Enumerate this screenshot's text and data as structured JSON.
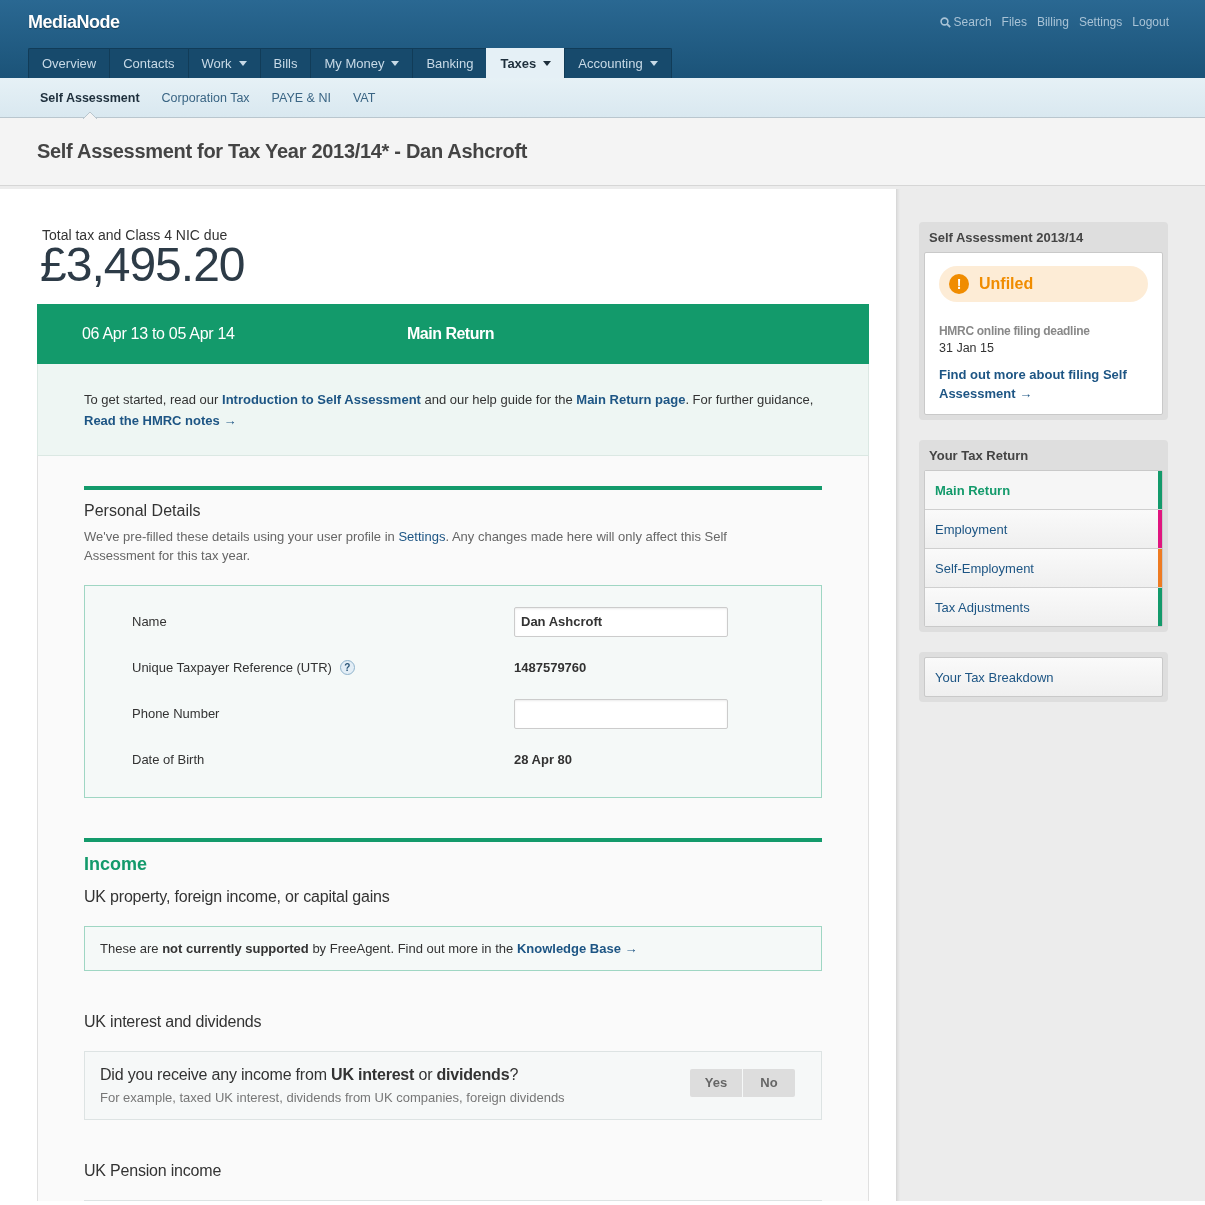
{
  "header": {
    "logo": "MediaNode",
    "links": [
      {
        "kind": "search",
        "label": "Search"
      },
      {
        "kind": "plain",
        "label": "Files"
      },
      {
        "kind": "plain",
        "label": "Billing"
      },
      {
        "kind": "plain",
        "label": "Settings"
      },
      {
        "kind": "plain",
        "label": "Logout"
      }
    ]
  },
  "nav": {
    "tabs": [
      {
        "label": "Overview",
        "dropdown": false,
        "selected": false
      },
      {
        "label": "Contacts",
        "dropdown": false,
        "selected": false
      },
      {
        "label": "Work",
        "dropdown": true,
        "selected": false
      },
      {
        "label": "Bills",
        "dropdown": false,
        "selected": false
      },
      {
        "label": "My Money",
        "dropdown": true,
        "selected": false
      },
      {
        "label": "Banking",
        "dropdown": false,
        "selected": false
      },
      {
        "label": "Taxes",
        "dropdown": true,
        "selected": true
      },
      {
        "label": "Accounting",
        "dropdown": true,
        "selected": false
      }
    ]
  },
  "subnav": {
    "items": [
      {
        "label": "Self Assessment",
        "selected": true
      },
      {
        "label": "Corporation Tax",
        "selected": false
      },
      {
        "label": "PAYE & NI",
        "selected": false
      },
      {
        "label": "VAT",
        "selected": false
      }
    ]
  },
  "page_title": "Self Assessment for Tax Year 2013/14* - Dan Ashcroft",
  "summary": {
    "label": "Total tax and Class 4 NIC due",
    "amount": "£3,495.20"
  },
  "return_bar": {
    "period": "06 Apr 13 to 05 Apr 14",
    "title": "Main Return"
  },
  "intro": {
    "parts": [
      {
        "kind": "text",
        "text": "To get started, read our "
      },
      {
        "kind": "link",
        "text": "Introduction to Self Assessment"
      },
      {
        "kind": "text",
        "text": " and our help guide for the "
      },
      {
        "kind": "link",
        "text": "Main Return page"
      },
      {
        "kind": "text",
        "text": ". For further guidance, "
      },
      {
        "kind": "link",
        "text": "Read the HMRC notes →"
      }
    ]
  },
  "personal_details": {
    "heading": "Personal Details",
    "description": [
      {
        "kind": "text",
        "text": "We've pre-filled these details using your user profile in "
      },
      {
        "kind": "link",
        "text": "Settings"
      },
      {
        "kind": "text",
        "text": ". Any changes made here will only affect this Self Assessment for this tax year."
      }
    ],
    "fields": [
      {
        "kind": "input",
        "label": "Name",
        "value": "Dan Ashcroft"
      },
      {
        "kind": "text",
        "label": "Unique Taxpayer Reference (UTR)",
        "help": "?",
        "value": "1487579760"
      },
      {
        "kind": "input",
        "label": "Phone Number"
      },
      {
        "kind": "text",
        "label": "Date of Birth",
        "value": "28 Apr 80"
      }
    ]
  },
  "income": {
    "heading": "Income",
    "sections": [
      {
        "kind": "notice",
        "title": "UK property, foreign income, or capital gains",
        "parts": [
          {
            "kind": "text",
            "text": "These are **not currently supported** by FreeAgent. Find out more in the "
          },
          {
            "kind": "link",
            "text": "Knowledge Base →"
          }
        ]
      },
      {
        "kind": "question",
        "title": "UK interest and dividends",
        "question": "Did you receive any income from **UK interest** or **dividends**?",
        "hint": "For example, taxed UK interest, dividends from UK companies, foreign dividends",
        "buttons": [
          "Yes",
          "No"
        ]
      },
      {
        "kind": "empty",
        "title": "UK Pension income"
      }
    ]
  },
  "sidebar": {
    "status_card": {
      "title": "Self Assessment 2013/14",
      "status_icon": "!",
      "status": "Unfiled",
      "deadline_label": "HMRC online filing deadline",
      "deadline": "31 Jan 15",
      "link": "Find out more about filing Self Assessment →"
    },
    "tax_return": {
      "title": "Your Tax Return",
      "items": [
        {
          "label": "Main Return",
          "selected": true,
          "color": "#139a6b"
        },
        {
          "label": "Employment",
          "selected": false,
          "color": "#e0157f"
        },
        {
          "label": "Self-Employment",
          "selected": false,
          "color": "#ee7b22"
        },
        {
          "label": "Tax Adjustments",
          "selected": false,
          "color": "#139a6b"
        }
      ]
    },
    "breakdown": {
      "label": "Your Tax Breakdown"
    }
  }
}
